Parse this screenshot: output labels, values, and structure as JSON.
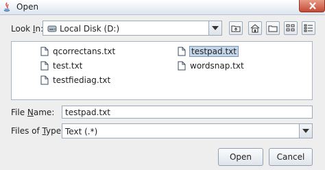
{
  "window": {
    "title": "Open"
  },
  "look_in": {
    "label_prefix": "Look ",
    "label_mnemonic": "I",
    "label_suffix": "n:",
    "value": "Local Disk (D:)"
  },
  "toolbar": {
    "buttons": [
      {
        "icon": "up-folder-icon"
      },
      {
        "icon": "home-icon"
      },
      {
        "icon": "new-folder-icon"
      },
      {
        "icon": "list-view-icon"
      },
      {
        "icon": "details-view-icon"
      }
    ]
  },
  "files": [
    {
      "name": "qcorrectans.txt",
      "selected": false
    },
    {
      "name": "test.txt",
      "selected": false
    },
    {
      "name": "testfiediag.txt",
      "selected": false
    },
    {
      "name": "testpad.txt",
      "selected": true
    },
    {
      "name": "wordsnap.txt",
      "selected": false
    }
  ],
  "file_name": {
    "label_prefix": "File ",
    "label_mnemonic": "N",
    "label_suffix": "ame:",
    "value": "testpad.txt"
  },
  "files_of_type": {
    "label_prefix": "Files of ",
    "label_mnemonic": "T",
    "label_suffix": "ype:",
    "value": "Text (.*)"
  },
  "buttons": {
    "open": "Open",
    "cancel": "Cancel"
  },
  "colors": {
    "selection_bg": "#c4d6ea",
    "selection_border": "#7a95b8",
    "close_red": "#c44b35"
  }
}
